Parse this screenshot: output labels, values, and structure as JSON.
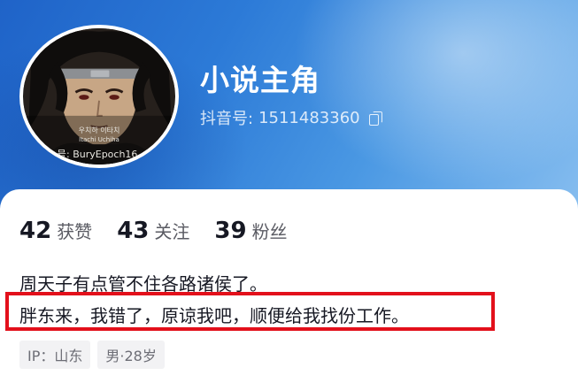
{
  "profile": {
    "nickname": "小说主角",
    "douyin_id_label": "抖音号:",
    "douyin_id": "1511483360",
    "avatar": {
      "line_kr": "우치하 이타치",
      "line_en": "Itachi Uchiha",
      "line_id": "号: BuryEpoch16"
    }
  },
  "stats": [
    {
      "value": "42",
      "label": "获赞"
    },
    {
      "value": "43",
      "label": "关注"
    },
    {
      "value": "39",
      "label": "粉丝"
    }
  ],
  "bio": {
    "line1": "周天子有点管不住各路诸侯了。",
    "line2": "胖东来，我错了，原谅我吧，顺便给我找份工作。"
  },
  "tags": [
    {
      "text": "IP：山东"
    },
    {
      "text": "男·28岁"
    }
  ],
  "colors": {
    "header_gradient_start": "#1f63c8",
    "header_gradient_end": "#86bdef",
    "highlight_border": "#e3101b",
    "text_primary": "#161823"
  }
}
